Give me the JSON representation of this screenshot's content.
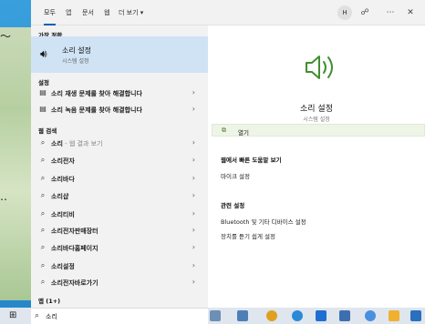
{
  "tabs": [
    {
      "label": "모두"
    },
    {
      "label": "앱"
    },
    {
      "label": "문서"
    },
    {
      "label": "웹"
    },
    {
      "label": "더 보기 ▾"
    }
  ],
  "avatar": {
    "initial": "H"
  },
  "best_match": {
    "section": "가장 정확",
    "title": "소리 설정",
    "subtitle": "시스템 설정"
  },
  "settings": {
    "section": "설정",
    "items": [
      {
        "label": "소리 재생 문제를 찾아 해결합니다"
      },
      {
        "label": "소리 녹음 문제를 찾아 해결합니다"
      }
    ]
  },
  "web": {
    "section": "웹 검색",
    "first": {
      "label": "소리",
      "sub": " - 웹 결과 보기"
    },
    "items": [
      {
        "label": "소리전자"
      },
      {
        "label": "소리바다"
      },
      {
        "label": "소리샵"
      },
      {
        "label": "소리티비"
      },
      {
        "label": "소리전자판매장터"
      },
      {
        "label": "소리바다홈페이지"
      },
      {
        "label": "소리설정"
      },
      {
        "label": "소리전자바로가기"
      }
    ]
  },
  "apps_section": "앱 (1+)",
  "detail": {
    "title": "소리 설정",
    "subtitle": "시스템 설정",
    "open_label": "열기",
    "quick_help": "웹에서 빠른 도움말 보기",
    "mic_setting": "마이크 설정",
    "related": "관련 설정",
    "link1": "Bluetooth 및 기타 디바이스 설정",
    "link2": "장치를 듣기 쉽게 설정"
  },
  "search": {
    "value": "소리"
  }
}
